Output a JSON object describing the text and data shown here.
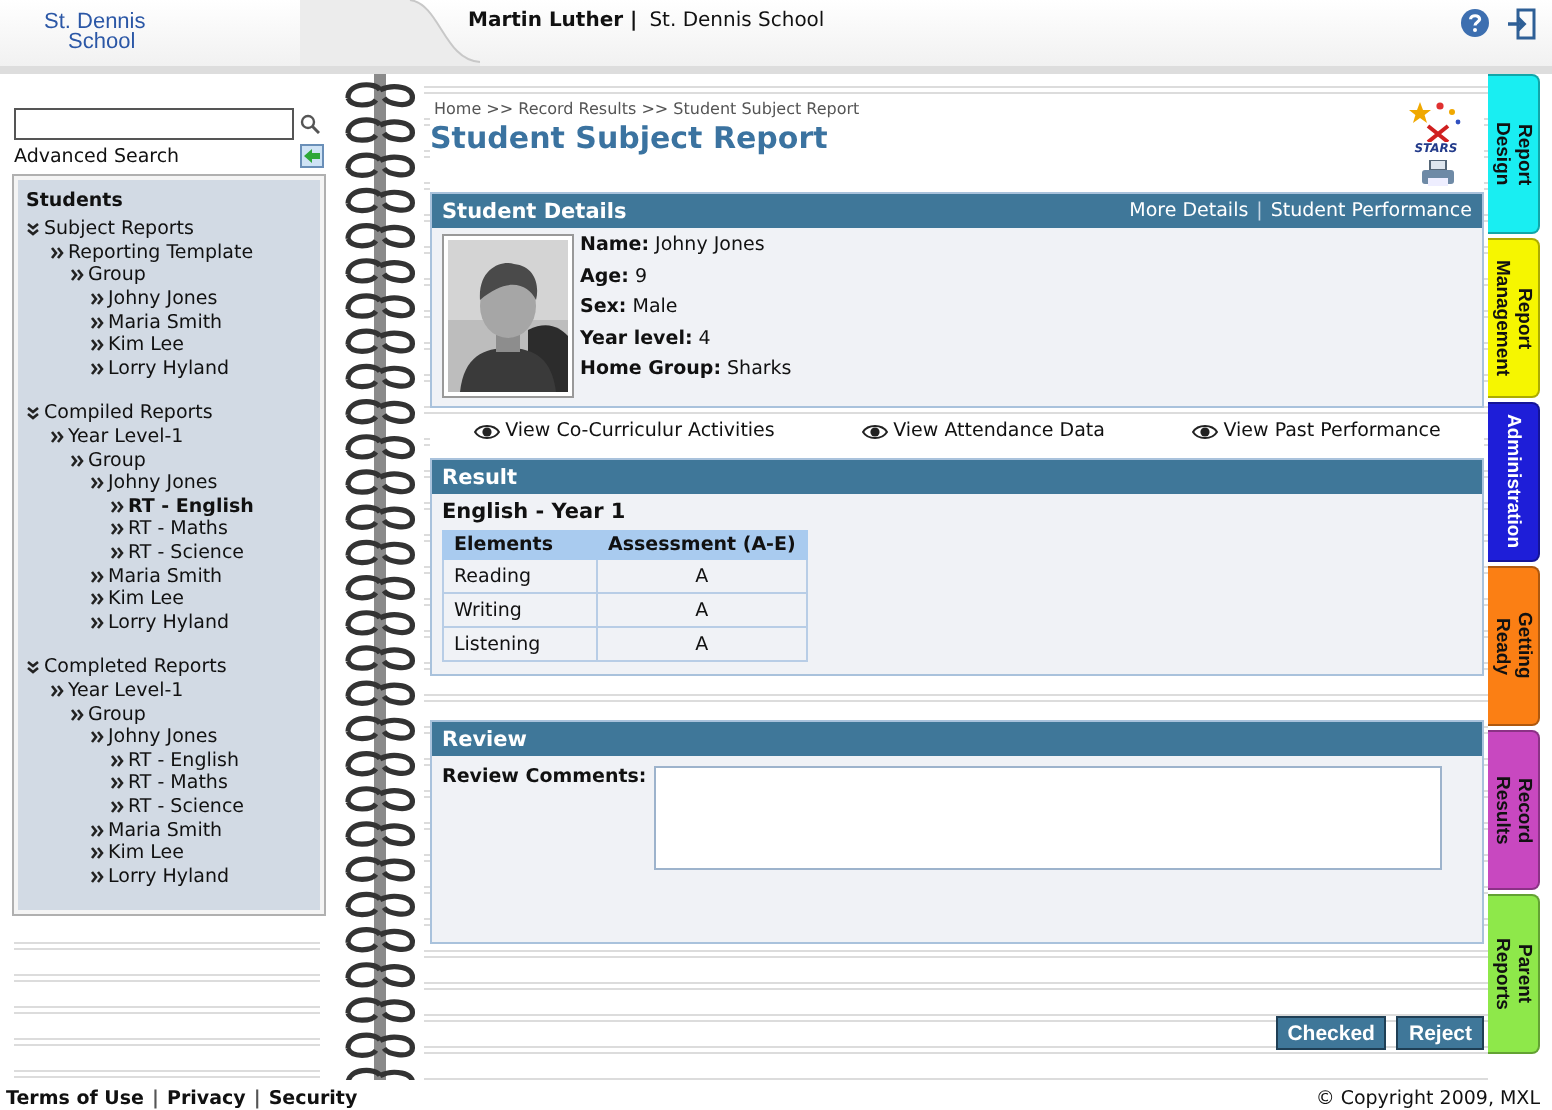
{
  "header": {
    "logo": [
      "St. Dennis",
      "School"
    ],
    "user": "Martin Luther |",
    "school": "St. Dennis School"
  },
  "advanced_search": "Advanced Search",
  "tree": {
    "title": "Students",
    "items": [
      {
        "label": "Subject Reports",
        "expanded": true,
        "selected": false,
        "children": [
          {
            "label": "Reporting Template",
            "selected": false,
            "children": [
              {
                "label": "Group",
                "selected": false,
                "children": [
                  {
                    "label": "Johny Jones",
                    "selected": false
                  },
                  {
                    "label": "Maria Smith",
                    "selected": false
                  },
                  {
                    "label": "Kim Lee",
                    "selected": false
                  },
                  {
                    "label": "Lorry Hyland",
                    "selected": false
                  }
                ]
              }
            ]
          }
        ]
      },
      {
        "label": "Compiled Reports",
        "expanded": true,
        "selected": false,
        "children": [
          {
            "label": "Year Level-1",
            "selected": false,
            "children": [
              {
                "label": "Group",
                "selected": false,
                "children": [
                  {
                    "label": "Johny Jones",
                    "selected": false,
                    "children": [
                      {
                        "label": "RT - English",
                        "selected": true
                      },
                      {
                        "label": "RT - Maths",
                        "selected": false
                      },
                      {
                        "label": "RT - Science",
                        "selected": false
                      }
                    ]
                  },
                  {
                    "label": "Maria Smith",
                    "selected": false
                  },
                  {
                    "label": "Kim Lee",
                    "selected": false
                  },
                  {
                    "label": "Lorry Hyland",
                    "selected": false
                  }
                ]
              }
            ]
          }
        ]
      },
      {
        "label": "Completed Reports",
        "expanded": true,
        "selected": false,
        "children": [
          {
            "label": "Year Level-1",
            "selected": false,
            "children": [
              {
                "label": "Group",
                "selected": false,
                "children": [
                  {
                    "label": "Johny Jones",
                    "selected": false,
                    "children": [
                      {
                        "label": "RT - English",
                        "selected": false
                      },
                      {
                        "label": "RT - Maths",
                        "selected": false
                      },
                      {
                        "label": "RT - Science",
                        "selected": false
                      }
                    ]
                  },
                  {
                    "label": "Maria Smith",
                    "selected": false
                  },
                  {
                    "label": "Kim Lee",
                    "selected": false
                  },
                  {
                    "label": "Lorry Hyland",
                    "selected": false
                  }
                ]
              }
            ]
          }
        ]
      }
    ]
  },
  "breadcrumb": "Home >> Record Results >> Student Subject Report",
  "page_title": "Student Subject Report",
  "brand_logo": "STARS",
  "student_details": {
    "title": "Student Details",
    "links": [
      {
        "kind": "link",
        "text": "More Details"
      },
      {
        "kind": "separator",
        "text": "|"
      },
      {
        "kind": "link",
        "text": "Student Performance"
      }
    ],
    "fields": [
      {
        "label": "Name:",
        "value": "Johny Jones"
      },
      {
        "label": "Age:",
        "value": "9"
      },
      {
        "label": "Sex:",
        "value": "Male"
      },
      {
        "label": "Year level:",
        "value": "4"
      },
      {
        "label": "Home Group:",
        "value": "Sharks"
      }
    ]
  },
  "view_links": [
    "View Co-Curriculur Activities",
    "View Attendance Data",
    "View Past Performance"
  ],
  "result": {
    "title": "Result",
    "subject": "English - Year 1",
    "columns": [
      "Elements",
      "Assessment (A-E)"
    ],
    "rows": [
      [
        "Reading",
        "A"
      ],
      [
        "Writing",
        "A"
      ],
      [
        "Listening",
        "A"
      ]
    ]
  },
  "review": {
    "title": "Review",
    "label": "Review Comments:"
  },
  "buttons": [
    "Checked",
    "Reject"
  ],
  "side_tabs": [
    {
      "label": "Report Design",
      "color": "#19eef2"
    },
    {
      "label": "Report Management",
      "color": "#f6f600"
    },
    {
      "label": "Administration",
      "color": "#1e1ed8"
    },
    {
      "label": "Getting Ready",
      "color": "#fb7f14"
    },
    {
      "label": "Record Results",
      "color": "#c848c0"
    },
    {
      "label": "Parent Reports",
      "color": "#8ee84a"
    }
  ],
  "footer": {
    "links": [
      {
        "kind": "link",
        "text": "Terms of Use"
      },
      {
        "kind": "separator",
        "text": "|"
      },
      {
        "kind": "link",
        "text": "Privacy"
      },
      {
        "kind": "separator",
        "text": "|"
      },
      {
        "kind": "link",
        "text": "Security"
      }
    ],
    "copyright": "© Copyright 2009, MXL"
  }
}
